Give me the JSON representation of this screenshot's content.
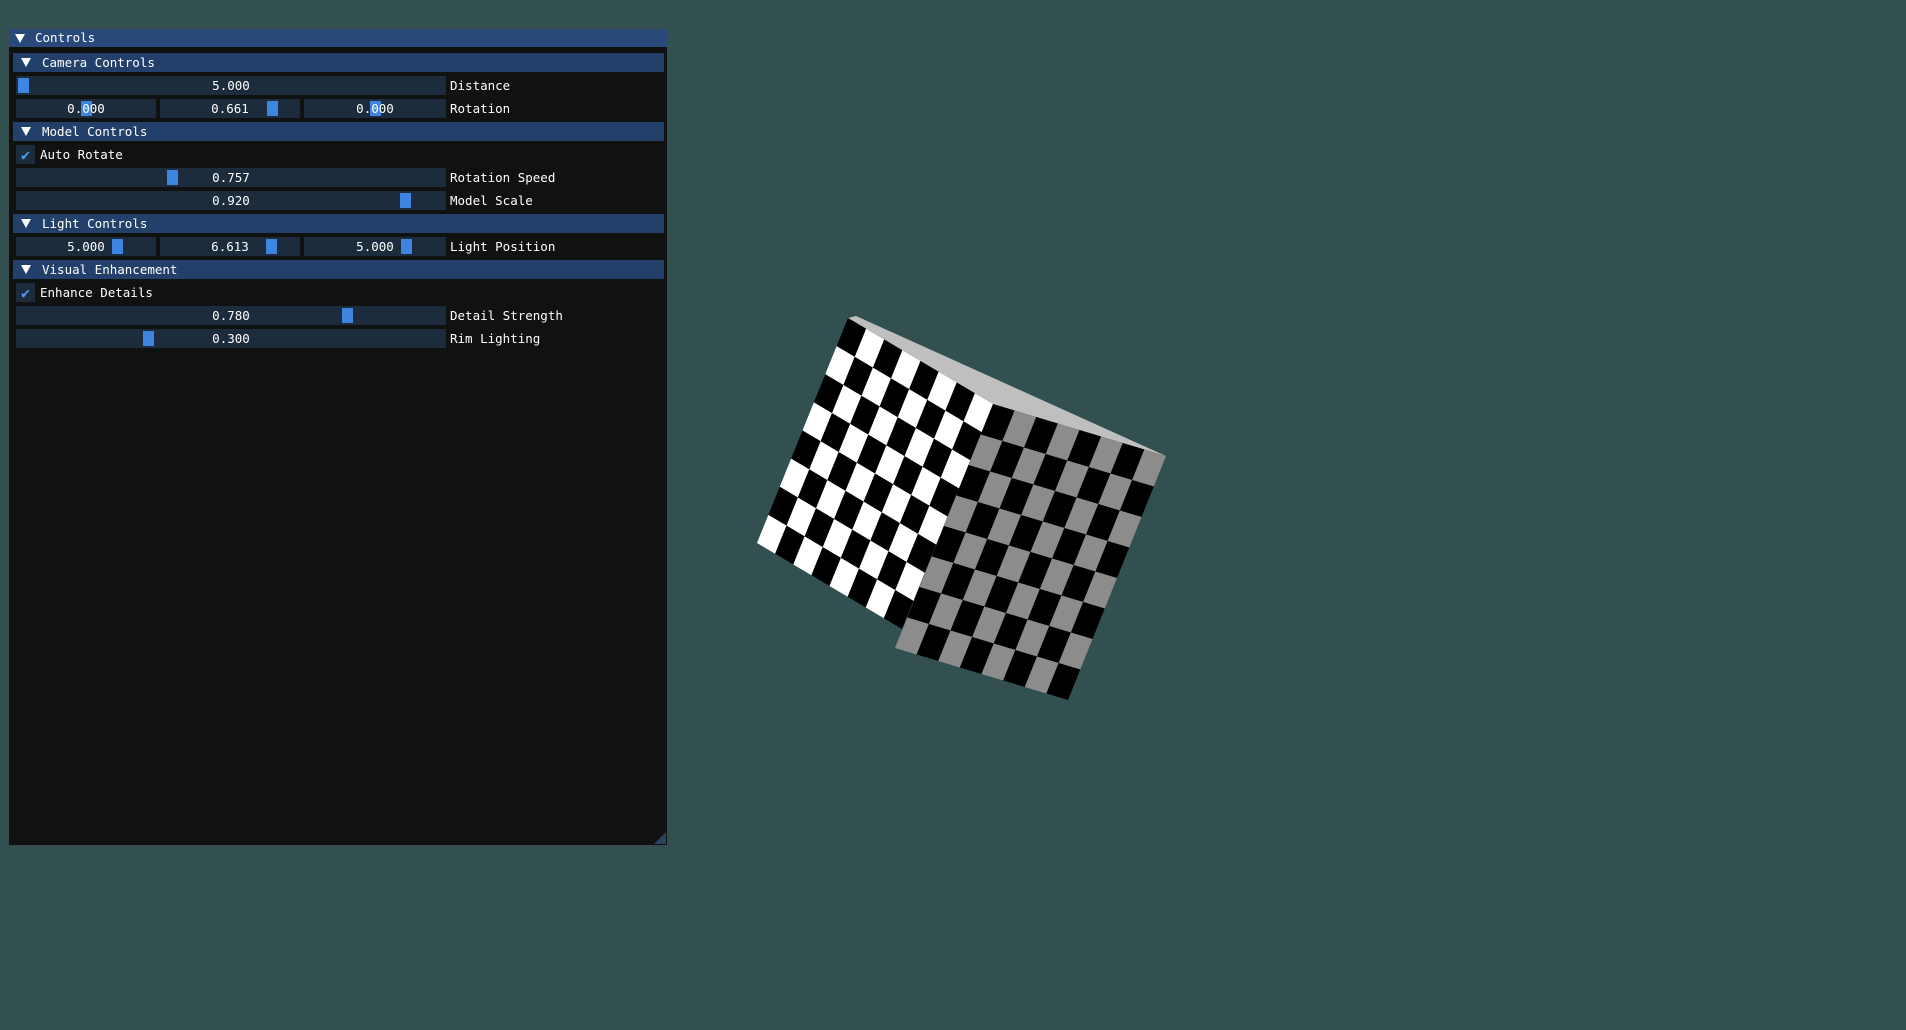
{
  "window": {
    "title": "Controls"
  },
  "sections": {
    "camera": {
      "title": "Camera Controls",
      "distance": {
        "label": "Distance",
        "value": "5.000",
        "fraction": 0.0
      },
      "rotation": {
        "label": "Rotation",
        "values": [
          "0.000",
          "0.661",
          "0.000"
        ],
        "fractions": [
          0.5,
          0.84,
          0.5
        ]
      }
    },
    "model": {
      "title": "Model Controls",
      "auto_rotate": {
        "label": "Auto Rotate",
        "checked": true
      },
      "rotation_speed": {
        "label": "Rotation Speed",
        "value": "0.757",
        "fraction": 0.36
      },
      "model_scale": {
        "label": "Model Scale",
        "value": "0.920",
        "fraction": 0.92
      }
    },
    "light": {
      "title": "Light Controls",
      "position": {
        "label": "Light Position",
        "values": [
          "5.000",
          "6.613",
          "5.000"
        ],
        "fractions": [
          0.75,
          0.83,
          0.75
        ]
      }
    },
    "visual": {
      "title": "Visual Enhancement",
      "enhance_details": {
        "label": "Enhance Details",
        "checked": true
      },
      "detail_strength": {
        "label": "Detail Strength",
        "value": "0.780",
        "fraction": 0.78
      },
      "rim_lighting": {
        "label": "Rim Lighting",
        "value": "0.300",
        "fraction": 0.3
      }
    }
  },
  "colors": {
    "background": "#335050",
    "accent": "#3d85e0",
    "header": "#23406b",
    "title_bar": "#29497a"
  },
  "scene": {
    "object": "checkerboard-cube",
    "checker_squares_per_edge": 8
  }
}
